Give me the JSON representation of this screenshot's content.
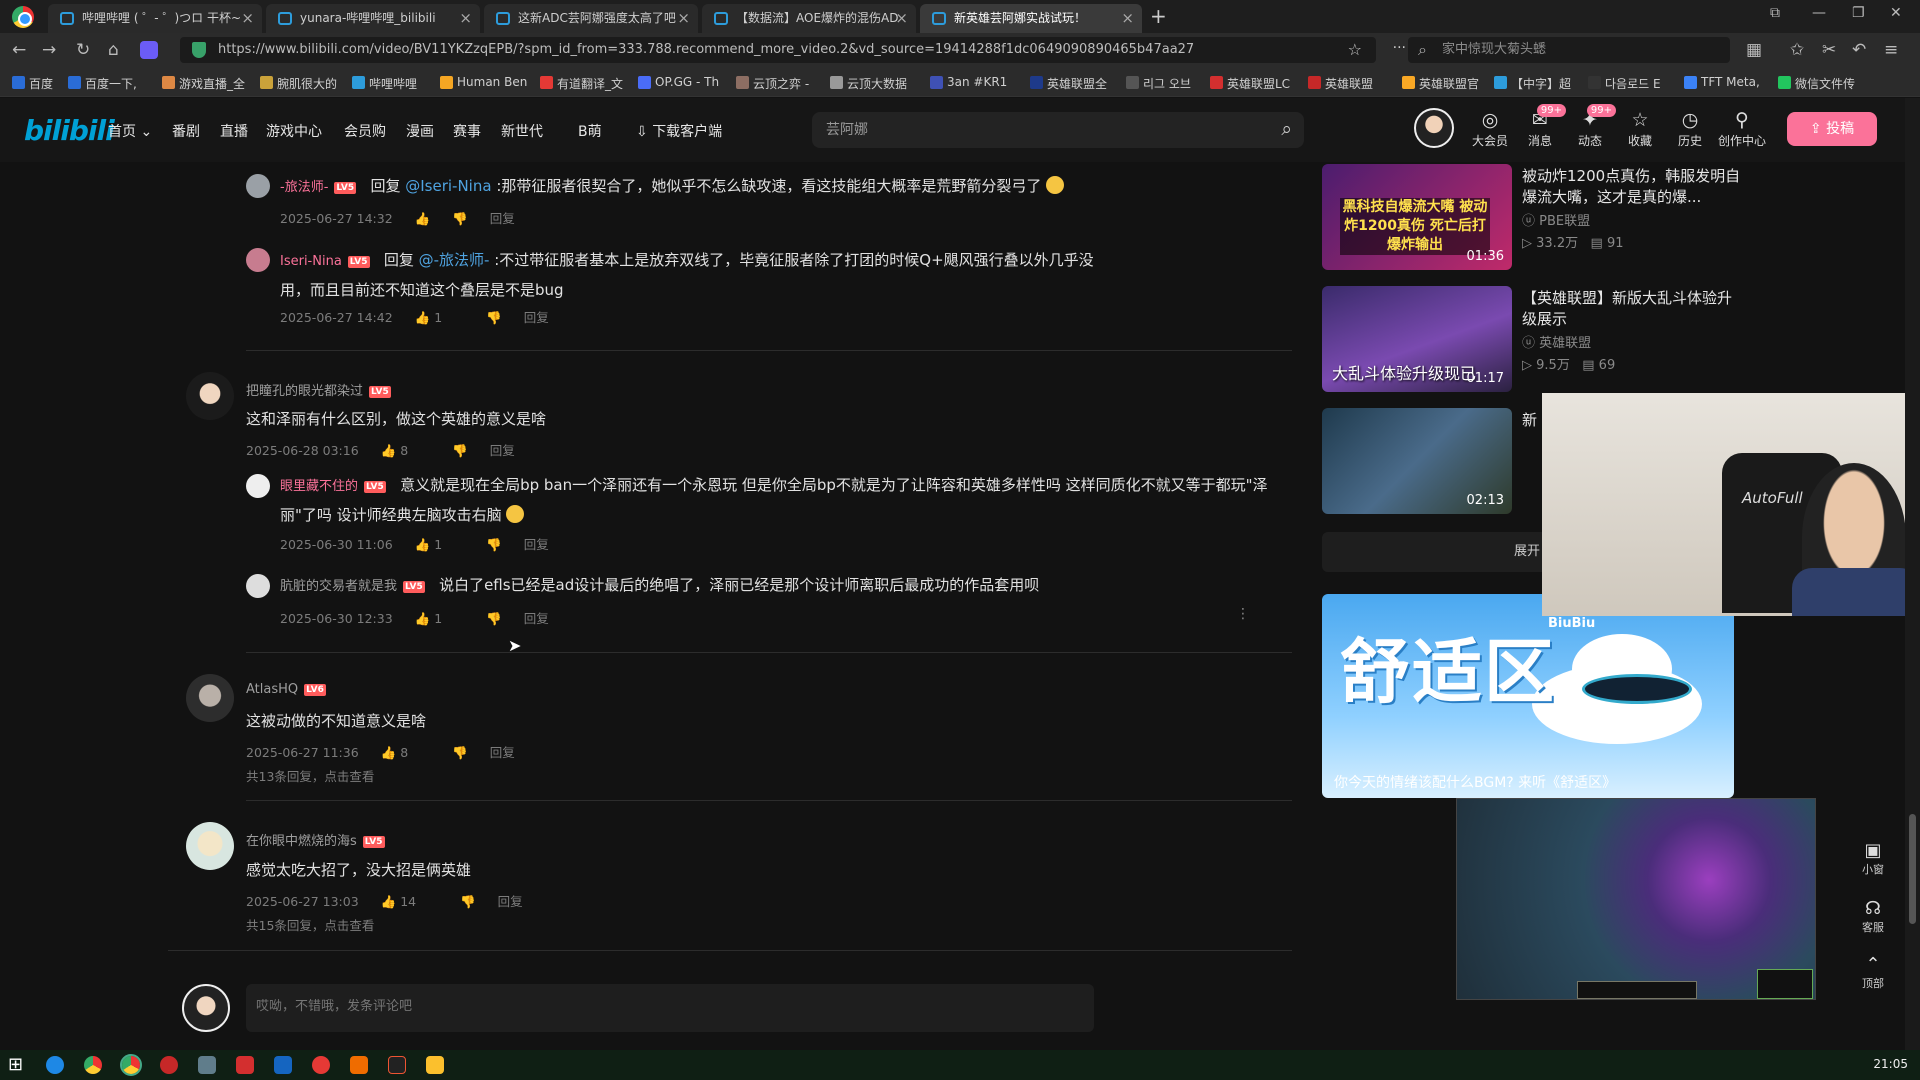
{
  "tabs": [
    {
      "title": "哔哩哔哩 ( ゜- ゜)つロ 干杯~"
    },
    {
      "title": "yunara-哔哩哔哩_bilibili"
    },
    {
      "title": "这新ADC芸阿娜强度太高了吧"
    },
    {
      "title": "【数据流】AOE爆炸的混伤AD"
    },
    {
      "title": "新英雄芸阿娜实战试玩！"
    }
  ],
  "address": {
    "url": "https://www.bilibili.com/video/BV11YKZzqEPB/?spm_id_from=333.788.recommend_more_video.2&vd_source=19414288f1dc0649090890465b47aa27",
    "search_placeholder": "家中惊现大菊头蟋"
  },
  "bookmarks": [
    "百度",
    "百度一下,",
    "游戏直播_全",
    "腕肌很大的",
    "哔哩哔哩",
    "Human Ben",
    "有道翻译_文",
    "OP.GG - Th",
    "云顶之弈 -",
    "云顶大数据",
    "3an #KR1 ",
    "英雄联盟全",
    "리그 오브",
    "英雄联盟LC",
    "英雄联盟",
    "英雄联盟官",
    "【中字】超",
    "다음로드 E",
    "TFT Meta,",
    "微信文件传"
  ],
  "bili_header": {
    "logo": "bilibili",
    "nav": [
      "首页",
      "番剧",
      "直播",
      "游戏中心",
      "会员购",
      "漫画",
      "赛事",
      "新世代",
      "B萌",
      "下载客户端"
    ],
    "search_value": "芸阿娜",
    "icons": [
      {
        "label": "大会员",
        "icon": "vip-icon"
      },
      {
        "label": "消息",
        "icon": "message-icon",
        "badge": "99+"
      },
      {
        "label": "动态",
        "icon": "dynamic-icon",
        "badge": "99+"
      },
      {
        "label": "收藏",
        "icon": "favorite-icon"
      },
      {
        "label": "历史",
        "icon": "history-icon"
      },
      {
        "label": "创作中心",
        "icon": "creator-icon"
      }
    ],
    "upload_label": "投稿"
  },
  "comments": {
    "r1": {
      "user": "-旅法师-",
      "lv": "LV5",
      "reply_word": "回复",
      "mention": "@Iseri-Nina",
      "sep": " :",
      "text": "那带征服者很契合了，她似乎不怎么缺攻速，看这技能组大概率是荒野箭分裂弓了",
      "date": "2025-06-27 14:32",
      "likes": "",
      "reply": "回复"
    },
    "r2": {
      "user": "Iseri-Nina",
      "lv": "LV5",
      "reply_word": "回复",
      "mention": "@-旅法师-",
      "sep": " :",
      "text": "不过带征服者基本上是放弃双线了，毕竟征服者除了打团的时候Q+飓风强行叠以外几乎没用，而且目前还不知道这个叠层是不是bug",
      "date": "2025-06-27 14:42",
      "likes": "1",
      "reply": "回复"
    },
    "c1": {
      "user": "把瞳孔的眼光都染过",
      "lv": "LV5",
      "text": "这和泽丽有什么区别，做这个英雄的意义是啥",
      "date": "2025-06-28 03:16",
      "likes": "8",
      "reply": "回复"
    },
    "c1r1": {
      "user": "眼里藏不住的",
      "lv": "LV5",
      "text": "意义就是现在全局bp ban一个泽丽还有一个永恩玩 但是你全局bp不就是为了让阵容和英雄多样性吗 这样同质化不就又等于都玩\"泽丽\"了吗 设计师经典左脑攻击右脑",
      "date": "2025-06-30 11:06",
      "likes": "1",
      "reply": "回复"
    },
    "c1r2": {
      "user": "肮脏的交易者就是我",
      "lv": "LV5",
      "text": "说白了efls已经是ad设计最后的绝唱了，泽丽已经是那个设计师离职后最成功的作品套用呗",
      "date": "2025-06-30 12:33",
      "likes": "1",
      "reply": "回复"
    },
    "c2": {
      "user": "AtlasHQ",
      "lv": "LV6",
      "text": "这被动做的不知道意义是啥",
      "date": "2025-06-27 11:36",
      "likes": "8",
      "reply": "回复",
      "more": "共13条回复，点击查看"
    },
    "c3": {
      "user": "在你眼中燃烧的海s",
      "lv": "LV5",
      "text": "感觉太吃大招了，没大招是俩英雄",
      "date": "2025-06-27 13:03",
      "likes": "14",
      "reply": "回复",
      "more": "共15条回复，点击查看"
    },
    "input_placeholder": "哎呦，不错哦，发条评论吧"
  },
  "recommendations": [
    {
      "title": "被动炸1200点真伤，韩服发明自爆流大嘴，这才是真的爆...",
      "up": "PBE联盟",
      "views": "33.2万",
      "danmaku": "91",
      "duration": "01:36",
      "thumb_text": "黑科技自爆流大嘴 被动炸1200真伤 死亡后打爆炸输出"
    },
    {
      "title": "【英雄联盟】新版大乱斗体验升级展示",
      "up": "英雄联盟",
      "views": "9.5万",
      "danmaku": "69",
      "duration": "01:17",
      "thumb_text": "大乱斗体验升级现已"
    },
    {
      "title": "新",
      "up": "",
      "views": "",
      "danmaku": "",
      "duration": "02:13",
      "thumb_text": ""
    }
  ],
  "expand_label": "展开",
  "ad": {
    "title": "舒适区",
    "tag": "BiuBiu",
    "caption": "你今天的情绪该配什么BGM? 来听《舒适区》"
  },
  "webcam": {
    "brand": "AutoFull"
  },
  "side_tools": [
    {
      "label": "小窗",
      "icon": "mini-window-icon"
    },
    {
      "label": "客服",
      "icon": "headset-icon"
    },
    {
      "label": "顶部",
      "icon": "top-arrow-icon"
    }
  ],
  "taskbar": {
    "time": "21:05"
  },
  "colors": {
    "accent_pink": "#fb7299",
    "bili_blue": "#00a1d6",
    "mention_blue": "#4fa3e0",
    "lv_red": "#ff5c5c"
  }
}
